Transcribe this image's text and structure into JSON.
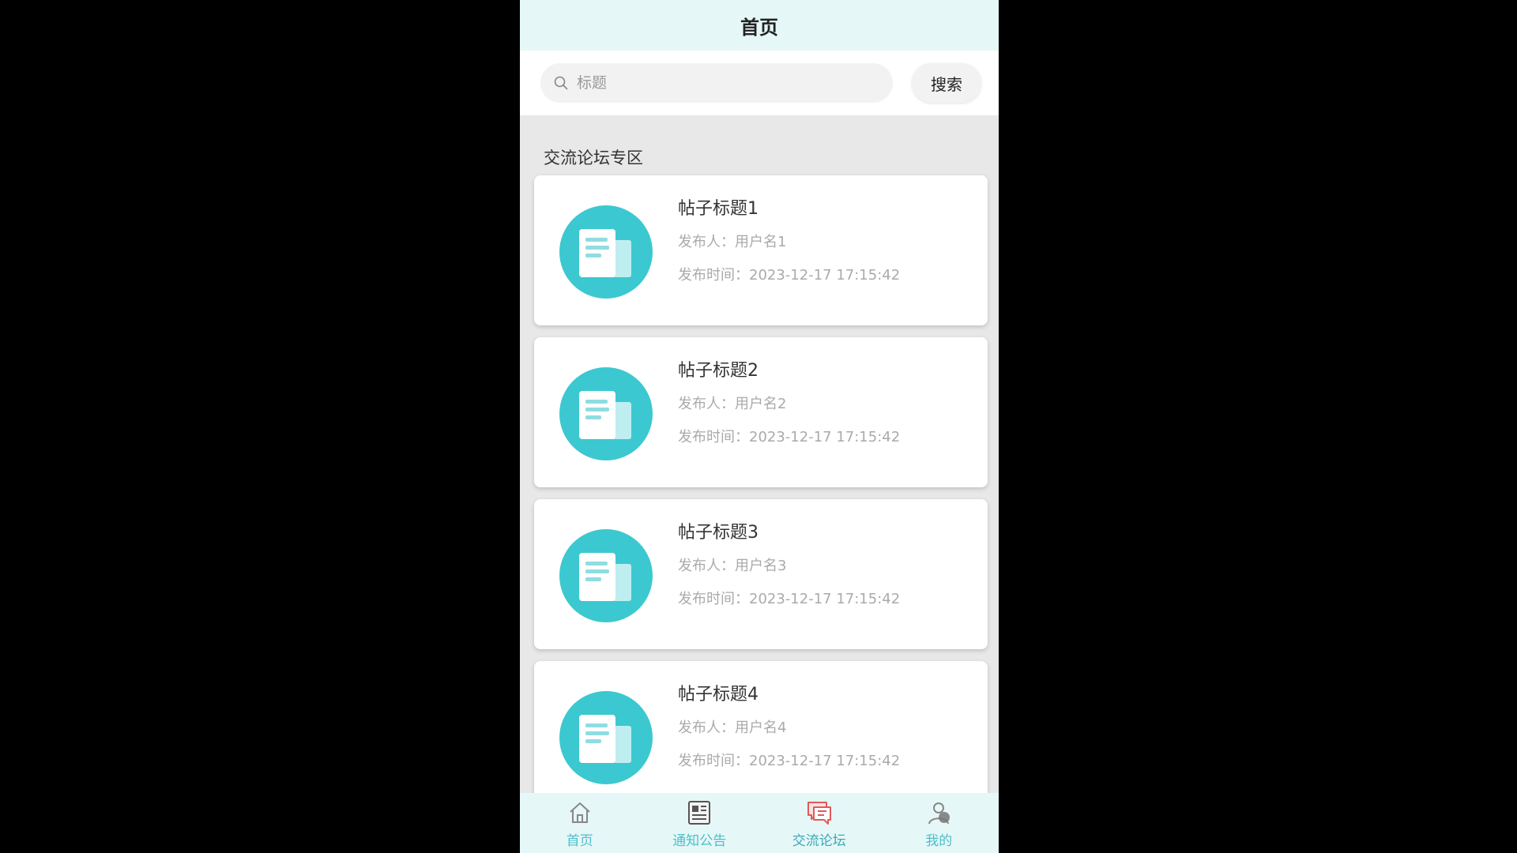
{
  "header": {
    "title": "首页"
  },
  "search": {
    "placeholder": "标题",
    "button_label": "搜索"
  },
  "section": {
    "title": "交流论坛专区"
  },
  "posts": [
    {
      "title": "帖子标题1",
      "author": "发布人：用户名1",
      "time": "发布时间：2023-12-17 17:15:42"
    },
    {
      "title": "帖子标题2",
      "author": "发布人：用户名2",
      "time": "发布时间：2023-12-17 17:15:42"
    },
    {
      "title": "帖子标题3",
      "author": "发布人：用户名3",
      "time": "发布时间：2023-12-17 17:15:42"
    },
    {
      "title": "帖子标题4",
      "author": "发布人：用户名4",
      "time": "发布时间：2023-12-17 17:15:42"
    }
  ],
  "tabbar": [
    {
      "label": "首页",
      "icon": "home-icon"
    },
    {
      "label": "通知公告",
      "icon": "notice-icon"
    },
    {
      "label": "交流论坛",
      "icon": "forum-icon",
      "active": true
    },
    {
      "label": "我的",
      "icon": "user-icon"
    }
  ],
  "colors": {
    "accent": "#3cc8d0",
    "tabbar_bg": "#e6f7f7",
    "header_bg": "#e6f7f7",
    "forum_icon": "#e05a5a"
  }
}
